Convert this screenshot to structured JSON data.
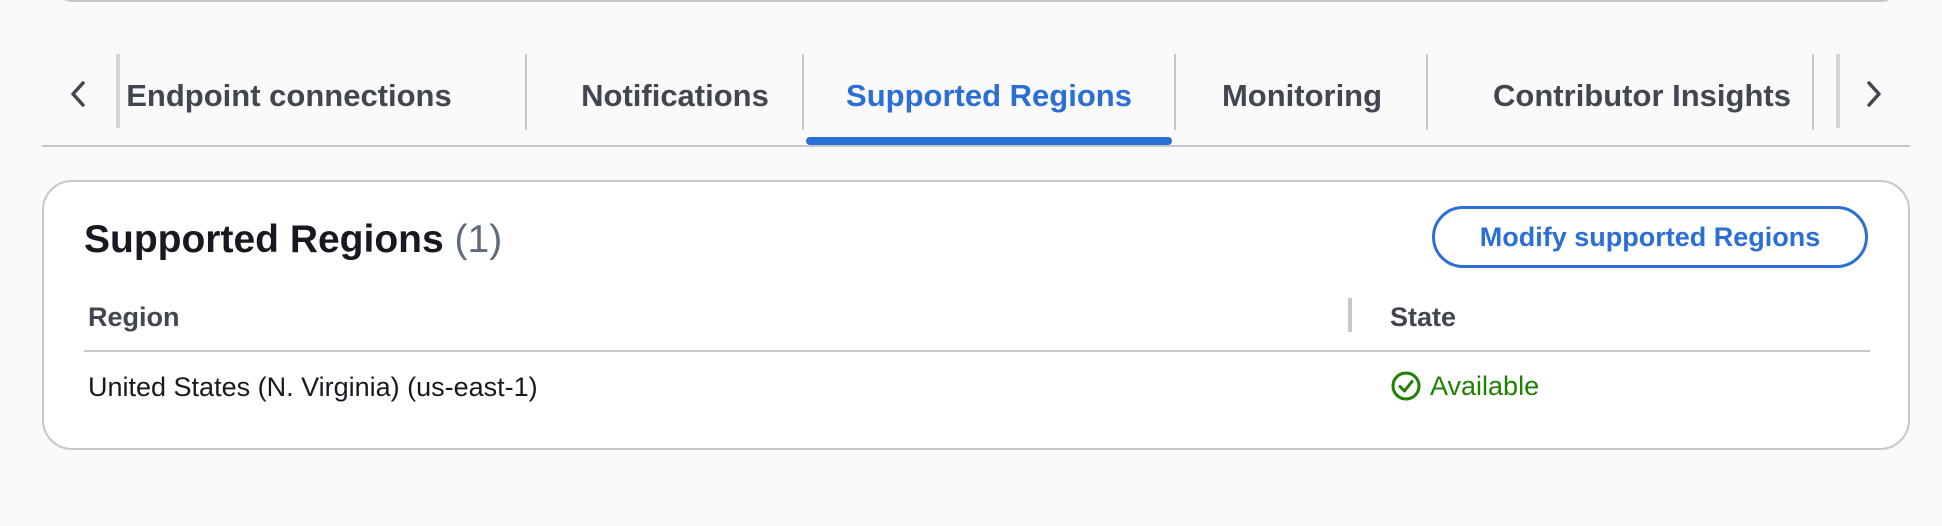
{
  "tabs": {
    "items": [
      {
        "label": "Endpoint connections"
      },
      {
        "label": "Notifications"
      },
      {
        "label": "Supported Regions"
      },
      {
        "label": "Monitoring"
      },
      {
        "label": "Contributor Insights"
      }
    ],
    "active": "Supported Regions",
    "scroll_left_icon": "chevron-left-icon",
    "scroll_right_icon": "chevron-right-icon"
  },
  "container": {
    "title": "Supported Regions",
    "count": "(1)",
    "modify_button_label": "Modify supported Regions"
  },
  "table": {
    "columns": [
      "Region",
      "State"
    ],
    "rows": [
      {
        "region": "United States (N. Virginia) (us-east-1)",
        "state": "Available",
        "state_icon": "check-circle-icon"
      }
    ]
  },
  "colors": {
    "accent": "#2a6ed6",
    "status_success": "#1d8102",
    "border": "#c6c6cd",
    "background": "#fafafa"
  }
}
